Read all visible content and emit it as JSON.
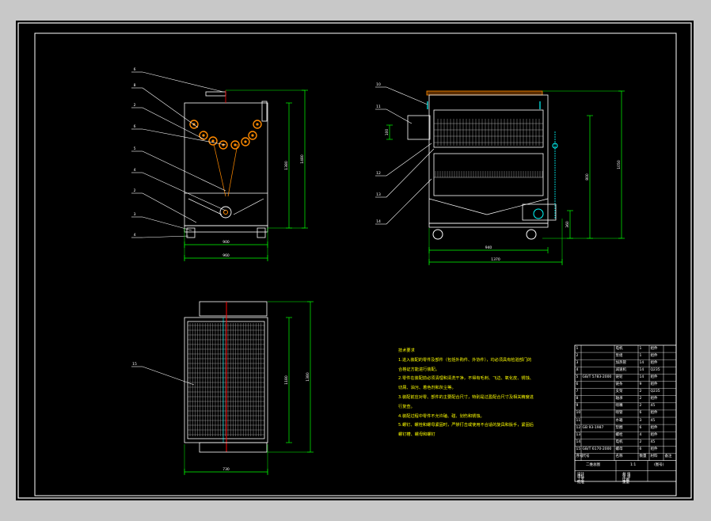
{
  "drawing": {
    "colors": {
      "sheet_background": "#000000",
      "outer_frame": "#ffffff",
      "inner_frame": "#ffffff",
      "outline": "#ffffff",
      "dimension": "#00ff00",
      "centerline": "#ff0000",
      "leader": "#ffffff",
      "mesh": "#cccccc",
      "spray_ring": "#ff8a00",
      "notes_text": "#ffff00",
      "pump": "#00ffff"
    },
    "front_view": {
      "dimensions": {
        "inner_width": "900",
        "outer_width": "960",
        "height_inner": "1380",
        "height_outer": "1480"
      },
      "balloons": [
        "6",
        "8",
        "2",
        "6",
        "5",
        "4",
        "2",
        "3",
        "4"
      ]
    },
    "side_view": {
      "dimensions": {
        "overall_length": "1370",
        "tank_length": "940",
        "overall_height": "1050",
        "mid_height": "800",
        "pump_height": "360",
        "top_offset": "100"
      },
      "balloons": [
        "10",
        "11",
        "12",
        "13",
        "14"
      ]
    },
    "plan_view": {
      "dimensions": {
        "width": "730",
        "depth_inner": "1180",
        "depth_outer": "1380"
      },
      "balloons": [
        "15"
      ]
    },
    "technical_notes": {
      "title": "技术要求",
      "lines": [
        "1.进入装配的零件及部件（包括外购件、外协件），均必须具有检验部门的",
        "合格证方能进行装配。",
        "2.零件在装配前必须清理和清洗干净，不得有毛刺、飞边、氧化皮、锈蚀、",
        "切屑、油污、着色剂和灰尘等。",
        "3.装配前应对零、部件的主要配合尺寸，特别是过盈配合尺寸及相关精度进",
        "行复查。",
        "4.装配过程中零件不允许磕、碰、划伤和锈蚀。",
        "5.螺钉、螺栓和螺母紧固时，严禁打击或使用不合适的旋具和扳手，紧固后",
        "螺钉槽、螺母和螺钉"
      ]
    },
    "title_block": {
      "rows": [
        [
          "1",
          "",
          "电机",
          "1",
          "组件"
        ],
        [
          "2",
          "",
          "泵组",
          "1",
          "组件"
        ],
        [
          "3",
          "",
          "加热管",
          "14",
          "组件"
        ],
        [
          "4",
          "",
          "减速机",
          "14",
          "Q235"
        ],
        [
          "5",
          "GB/T 5783-2000",
          "链轮",
          "14",
          "组件"
        ],
        [
          "6",
          "",
          "链条",
          "9",
          "组件"
        ],
        [
          "7",
          "",
          "支架",
          "2",
          "Q235"
        ],
        [
          "8",
          "",
          "轴承",
          "2",
          "组件"
        ],
        [
          "9",
          "",
          "喷嘴",
          "2",
          "45"
        ],
        [
          "10",
          "",
          "喷管",
          "6",
          "组件"
        ],
        [
          "11",
          "",
          "水箱",
          "3",
          "45"
        ],
        [
          "12",
          "GB 93-1987",
          "垫圈",
          "6",
          "组件"
        ],
        [
          "13",
          "",
          "螺栓",
          "4",
          "组件"
        ],
        [
          "14",
          "",
          "电机",
          "2",
          "45"
        ],
        [
          "15",
          "GB/T 6170-2000",
          "螺母",
          "6",
          "组件"
        ]
      ],
      "header": [
        "序号",
        "代号",
        "名称",
        "数量",
        "材料",
        "备注"
      ],
      "drawing_name": "二维总图",
      "drawing_no": "(图号)",
      "scale": "1:1",
      "footer_left": [
        "设计",
        "审核",
        "工艺",
        "批准"
      ],
      "footer_right": [
        "共 张",
        "第 张",
        "比例",
        "重量"
      ]
    }
  }
}
